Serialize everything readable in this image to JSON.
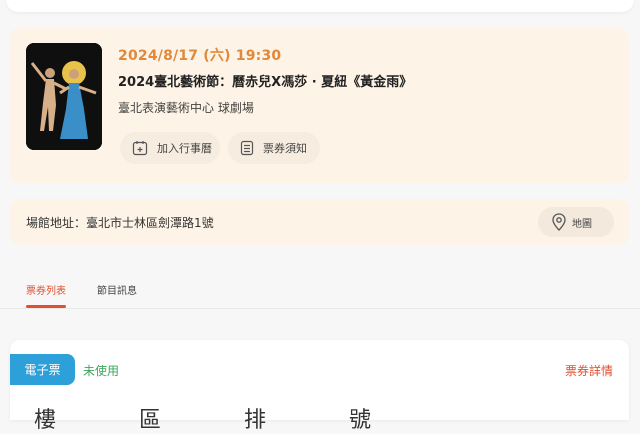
{
  "event": {
    "date": "2024/8/17 (六) 19:30",
    "title": "2024臺北藝術節：曆赤兒X馮莎 · 夏紐《黃金雨》",
    "venue": "臺北表演藝術中心 球劇場",
    "add_calendar_label": "加入行事曆",
    "ticket_notice_label": "票券須知"
  },
  "address": {
    "text": "場館地址：臺北市士林區劍潭路1號",
    "map_label": "地圖"
  },
  "tabs": [
    {
      "label": "票券列表",
      "active": true
    },
    {
      "label": "節目訊息",
      "active": false
    }
  ],
  "ticket": {
    "type_label": "電子票",
    "status": "未使用",
    "detail_link": "票券詳情",
    "partial_text": "樓 區 排 號"
  },
  "colors": {
    "accent_orange": "#e0893a",
    "tab_active": "#e0502e",
    "ticket_blue": "#2d9fd9",
    "status_green": "#3aa65a"
  }
}
